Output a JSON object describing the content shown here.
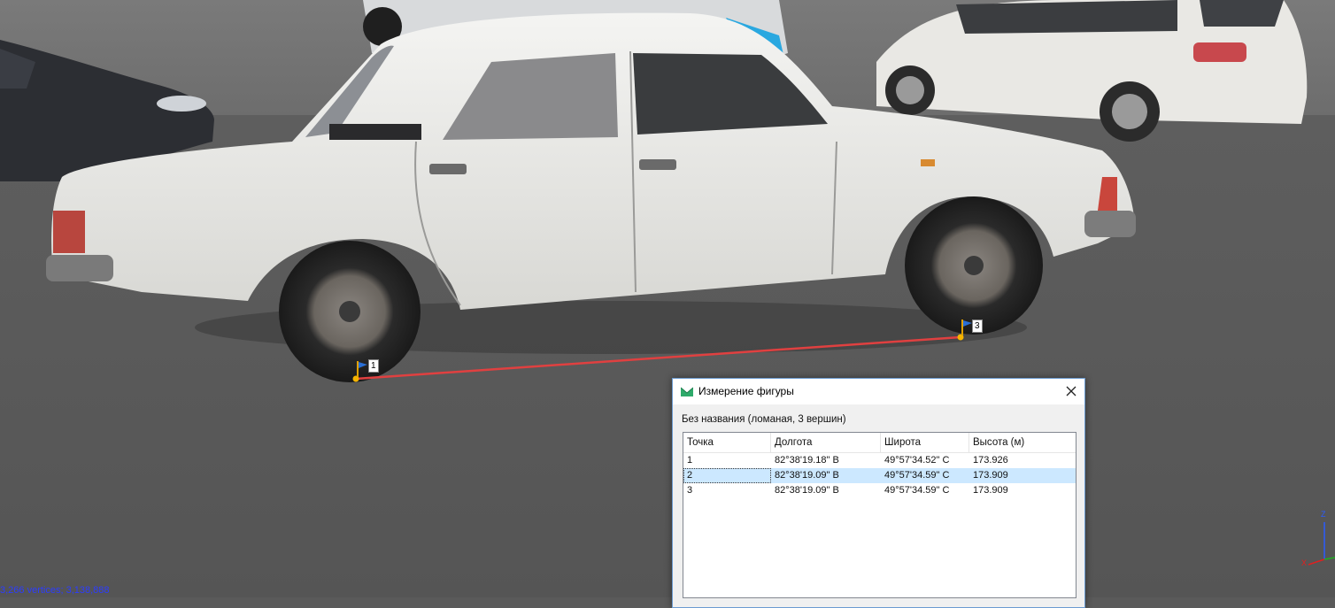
{
  "viewport": {
    "status_text": "3,266 vertices; 3,138,888",
    "markers": [
      {
        "id": "1",
        "label": "1"
      },
      {
        "id": "3",
        "label": "3"
      }
    ],
    "axis_gizmo": {
      "z": "Z",
      "x": "X"
    },
    "colors": {
      "measure_line": "#e04040",
      "marker_dot": "#f5b400",
      "status_text": "#2c3cff"
    }
  },
  "dialog": {
    "title": "Измерение фигуры",
    "close_icon": "close-icon",
    "subtitle": "Без названия (ломаная, 3 вершин)",
    "columns": [
      "Точка",
      "Долгота",
      "Широта",
      "Высота (м)"
    ],
    "rows": [
      {
        "point": "1",
        "lon": "82°38'19.18\" В",
        "lat": "49°57'34.52\" С",
        "alt": "173.926"
      },
      {
        "point": "2",
        "lon": "82°38'19.09\" В",
        "lat": "49°57'34.59\" С",
        "alt": "173.909"
      },
      {
        "point": "3",
        "lon": "82°38'19.09\" В",
        "lat": "49°57'34.59\" С",
        "alt": "173.909"
      }
    ],
    "selected_row": "2"
  }
}
